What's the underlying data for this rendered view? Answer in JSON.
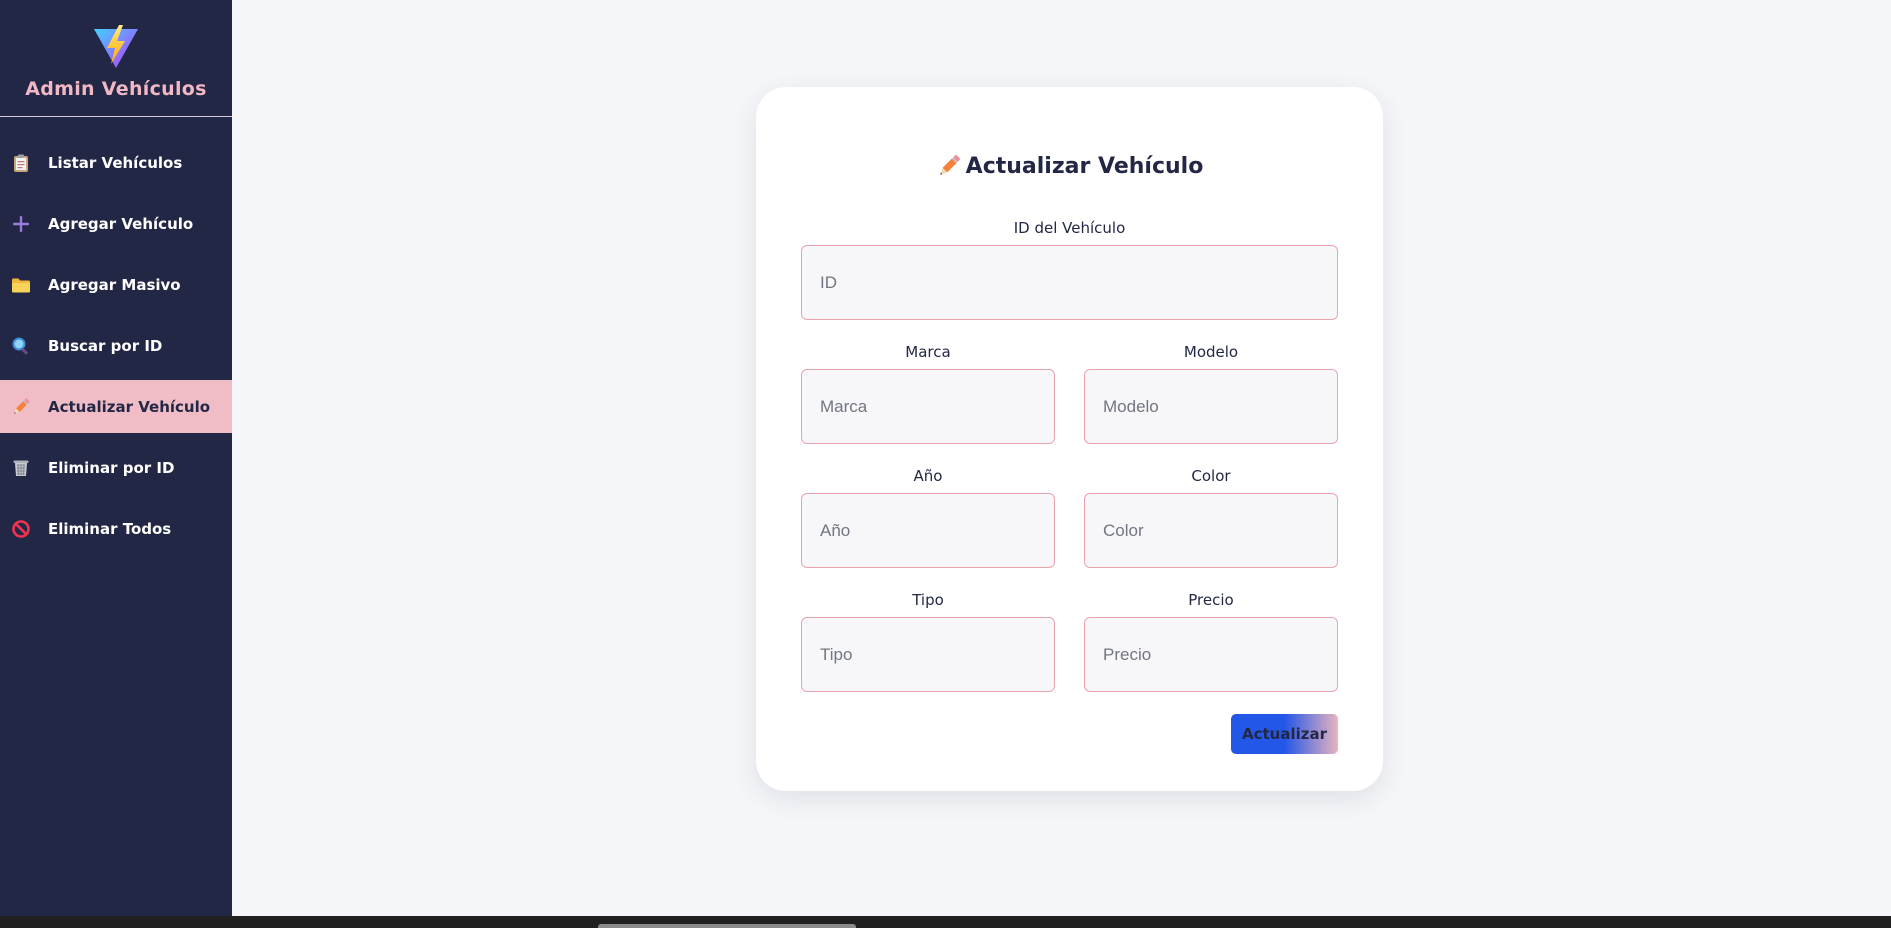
{
  "brand": {
    "title": "Admin Vehículos",
    "logo_icon": "vite-logo-icon"
  },
  "sidebar": {
    "items": [
      {
        "label": "Listar Vehículos",
        "icon": "clipboard-icon",
        "active": false
      },
      {
        "label": "Agregar Vehículo",
        "icon": "plus-icon",
        "active": false
      },
      {
        "label": "Agregar Masivo",
        "icon": "folder-icon",
        "active": false
      },
      {
        "label": "Buscar por ID",
        "icon": "magnifier-icon",
        "active": false
      },
      {
        "label": "Actualizar Vehículo",
        "icon": "pencil-icon",
        "active": true
      },
      {
        "label": "Eliminar por ID",
        "icon": "wastebasket-icon",
        "active": false
      },
      {
        "label": "Eliminar Todos",
        "icon": "prohibited-icon",
        "active": false
      }
    ]
  },
  "form": {
    "title": "Actualizar Vehículo",
    "title_icon": "pencil-icon",
    "fields": {
      "id": {
        "label": "ID del Vehículo",
        "placeholder": "ID",
        "value": ""
      },
      "marca": {
        "label": "Marca",
        "placeholder": "Marca",
        "value": ""
      },
      "modelo": {
        "label": "Modelo",
        "placeholder": "Modelo",
        "value": ""
      },
      "anio": {
        "label": "Año",
        "placeholder": "Año",
        "value": ""
      },
      "color": {
        "label": "Color",
        "placeholder": "Color",
        "value": ""
      },
      "tipo": {
        "label": "Tipo",
        "placeholder": "Tipo",
        "value": ""
      },
      "precio": {
        "label": "Precio",
        "placeholder": "Precio",
        "value": ""
      }
    },
    "submit_label": "Actualizar"
  },
  "colors": {
    "sidebar_bg": "#232746",
    "active_item_bg": "#f0bcc6",
    "brand_title": "#f2b7c4",
    "input_border": "#eaa4ae",
    "button_blue": "#2357e8",
    "page_bg": "#f5f6f9"
  }
}
